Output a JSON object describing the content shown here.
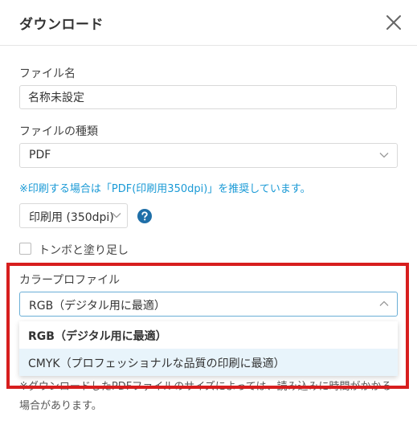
{
  "dialog": {
    "title": "ダウンロード",
    "close_icon": "close-icon"
  },
  "file_name": {
    "label": "ファイル名",
    "value": "名称未設定"
  },
  "file_type": {
    "label": "ファイルの種類",
    "selected": "PDF"
  },
  "info_text": "※印刷する場合は「PDF(印刷用350dpi)」を推奨しています。",
  "resolution": {
    "selected": "印刷用 (350dpi)",
    "help_icon": "help-icon"
  },
  "trim_marks": {
    "label": "トンボと塗り足し",
    "checked": false
  },
  "color_profile": {
    "label": "カラープロファイル",
    "selected": "RGB（デジタル用に最適）",
    "options": [
      "RGB（デジタル用に最適）",
      "CMYK（プロフェッショナルな品質の印刷に最適）"
    ]
  },
  "note": "※ダウンロードしたPDFファイルのサイズによっては、読み込みに時間がかかる場合があります。",
  "colors": {
    "accent": "#1a9ad6",
    "highlight_border": "#d71e1e",
    "hover_option": "#e8f4fb"
  }
}
